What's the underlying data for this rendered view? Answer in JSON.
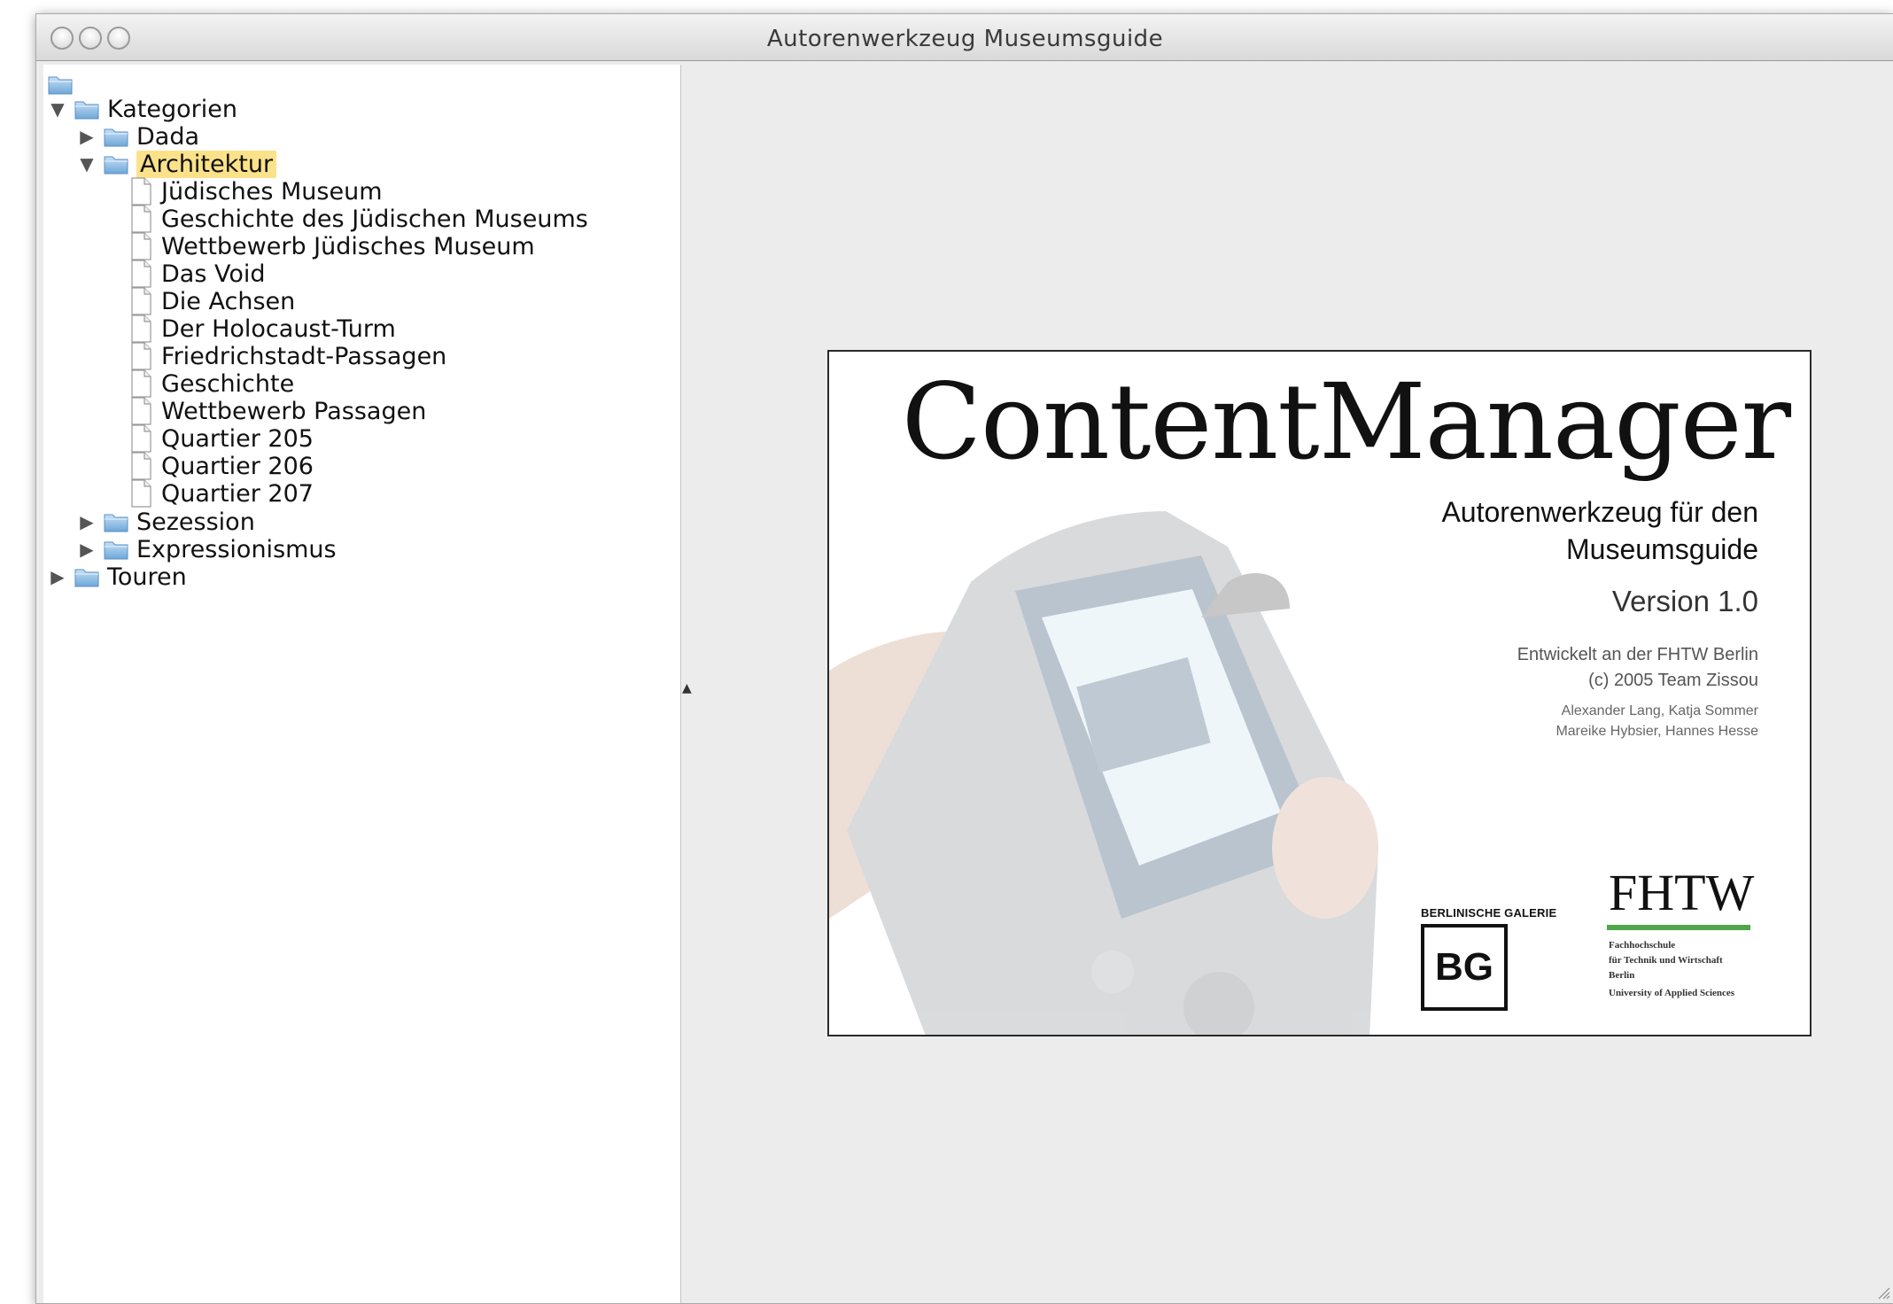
{
  "window": {
    "title": "Autorenwerkzeug Museumsguide"
  },
  "tree": {
    "root": "Kategorien",
    "categories": [
      {
        "label": "Dada",
        "expanded": false
      },
      {
        "label": "Architektur",
        "expanded": true,
        "selected": true,
        "children": [
          "Jüdisches Museum",
          "Geschichte des Jüdischen Museums",
          "Wettbewerb Jüdisches Museum",
          "Das Void",
          "Die Achsen",
          "Der Holocaust-Turm",
          "Friedrichstadt-Passagen",
          "Geschichte",
          "Wettbewerb Passagen",
          "Quartier 205",
          "Quartier 206",
          "Quartier 207"
        ]
      },
      {
        "label": "Sezession",
        "expanded": false
      },
      {
        "label": "Expressionismus",
        "expanded": false
      }
    ],
    "tours": "Touren"
  },
  "splash": {
    "title": "ContentManager",
    "subtitle_line1": "Autorenwerkzeug für den",
    "subtitle_line2": "Museumsguide",
    "version": "Version 1.0",
    "developed_line1": "Entwickelt an der FHTW Berlin",
    "developed_line2": "(c) 2005 Team Zissou",
    "authors_line1": "Alexander Lang, Katja Sommer",
    "authors_line2": "Mareike Hybsier, Hannes Hesse",
    "bg_label": "BERLINISCHE GALERIE",
    "bg_logo": "BG",
    "fhtw_logo": "FHTW",
    "fhtw_line1": "Fachhochschule",
    "fhtw_line2": "für Technik und Wirtschaft",
    "fhtw_line3": "Berlin",
    "fhtw_line4": "University of Applied Sciences"
  },
  "colors": {
    "selection": "#fbe28a",
    "folder": "#7fb3e0",
    "fhtw_green": "#4fa64a"
  }
}
